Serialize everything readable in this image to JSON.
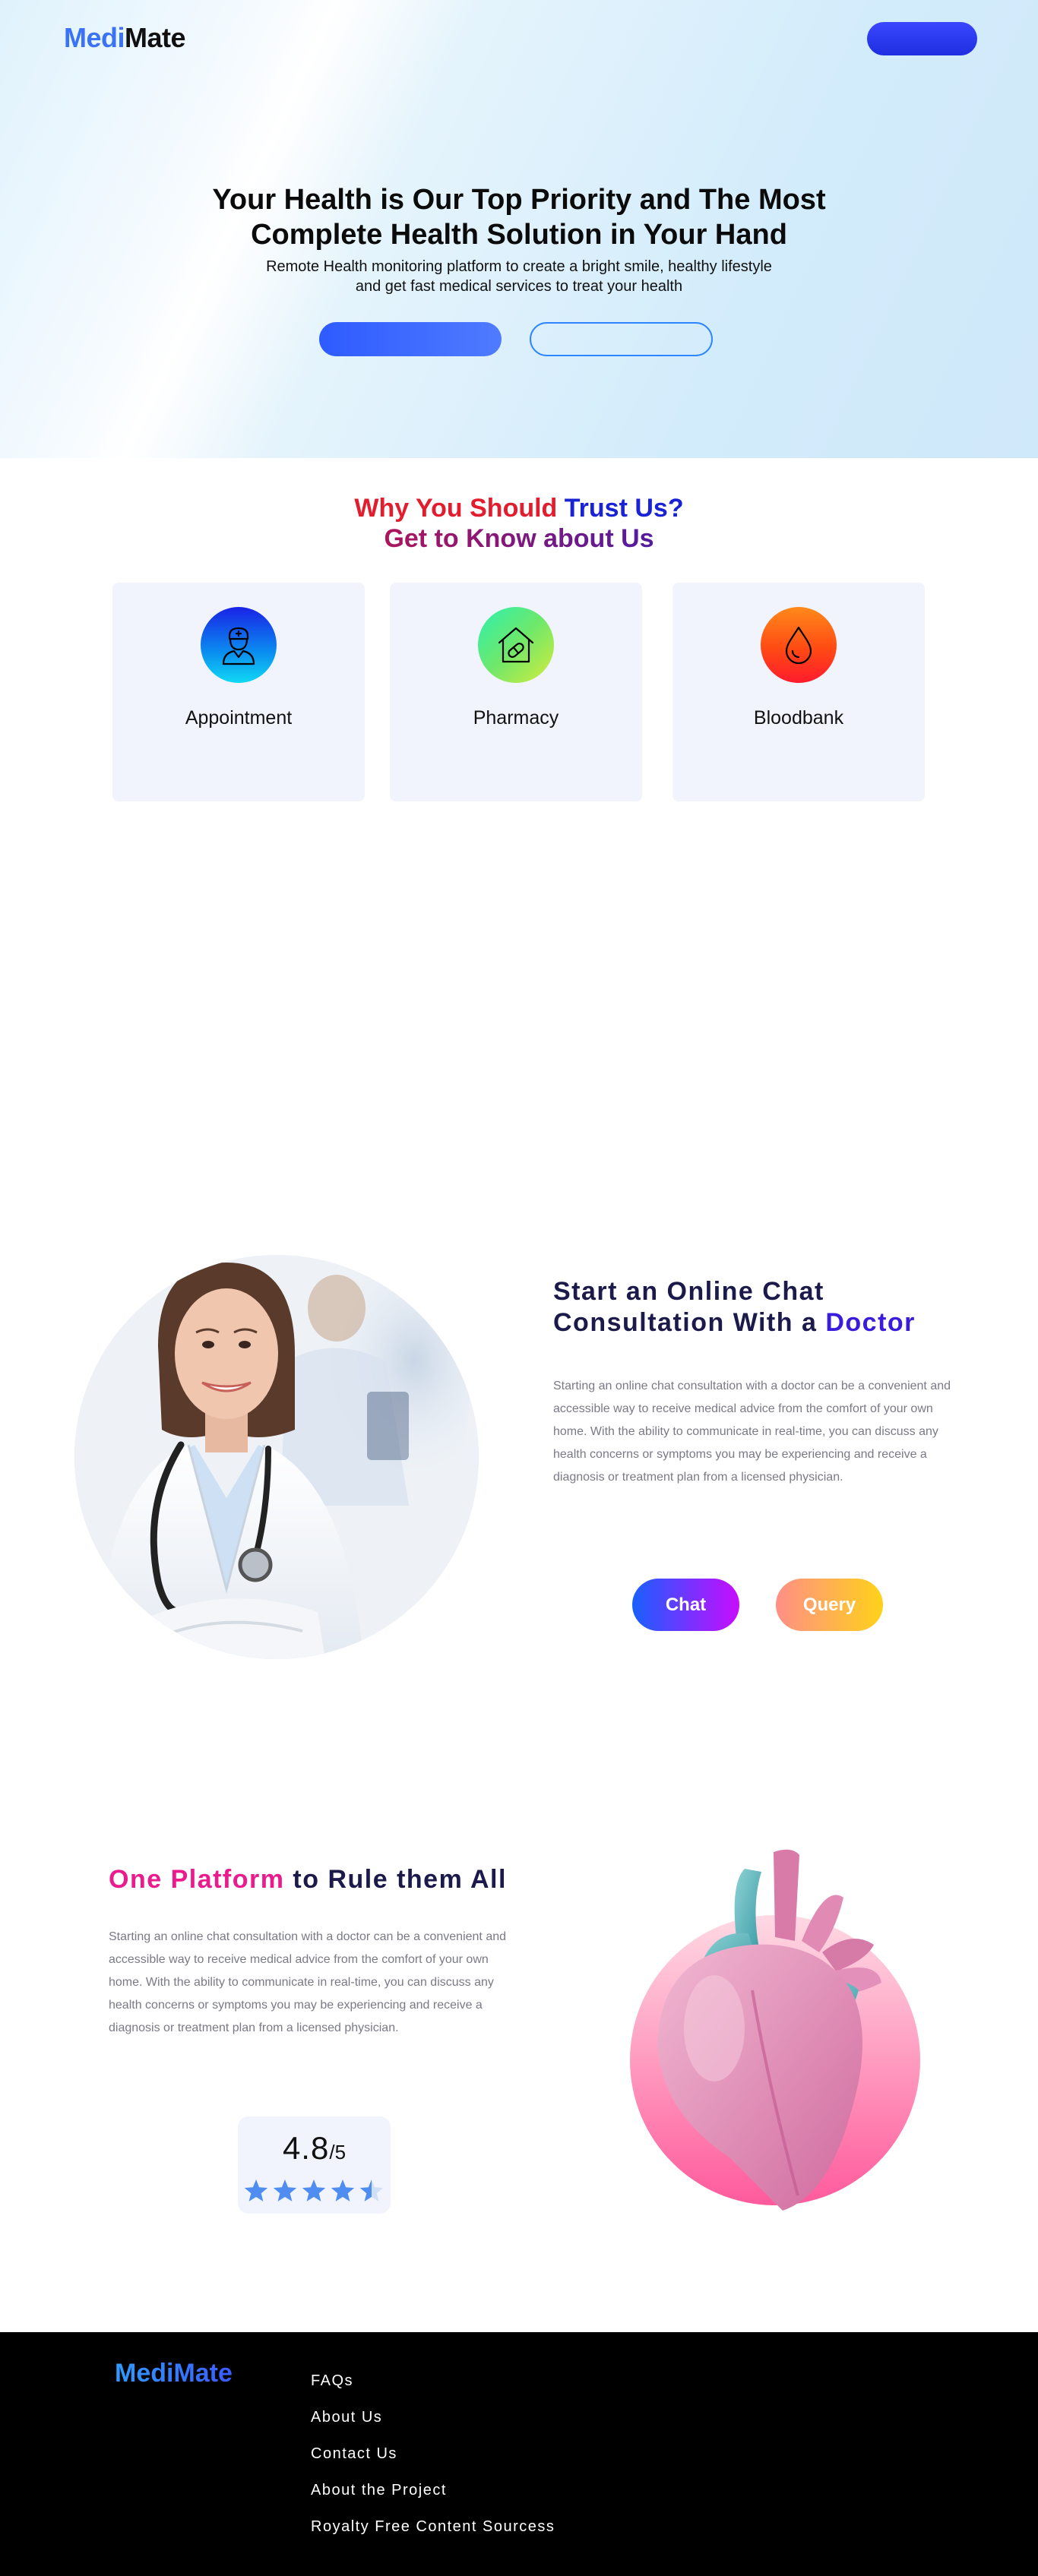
{
  "header": {
    "logo_part1": "Medi",
    "logo_part2": "Mate"
  },
  "hero": {
    "title": "Your Health is Our Top Priority and The Most Complete Health Solution in Your Hand",
    "subtitle": "Remote Health monitoring platform to create a bright smile, healthy lifestyle and get fast medical services to treat your health"
  },
  "why": {
    "line1_part1": "Why You Should ",
    "line1_trust": "Trust",
    "line1_part3": " Us?",
    "line2": "Get to Know about Us",
    "cards": [
      {
        "label": "Appointment",
        "icon": "doctor-icon"
      },
      {
        "label": "Pharmacy",
        "icon": "pharmacy-icon"
      },
      {
        "label": "Bloodbank",
        "icon": "blood-drop-icon"
      }
    ]
  },
  "chat": {
    "title_part1": "Start an Online Chat Consultation With a ",
    "title_highlight": "Doctor",
    "text": "Starting an online chat consultation with a doctor can be a convenient and accessible way to receive medical advice from the comfort of your own home. With the ability to communicate in real-time, you can discuss any health concerns or symptoms you may be experiencing and receive a diagnosis or treatment plan from a licensed physician.",
    "chat_button": "Chat",
    "query_button": "Query"
  },
  "platform": {
    "title_highlight": "One Platform",
    "title_rest": " to Rule them All",
    "text": "Starting an online chat consultation with a doctor can be a convenient and accessible way to receive medical advice from the comfort of your own home. With the ability to communicate in real-time, you can discuss any health concerns or symptoms you may be experiencing and receive a diagnosis or treatment plan from a licensed physician.",
    "rating_value": "4.8",
    "rating_max": "/5",
    "stars": 4.5
  },
  "footer": {
    "logo": "MediMate",
    "links": [
      "FAQs",
      "About Us",
      "Contact Us",
      "About the Project",
      "Royalty Free Content Sourcess"
    ]
  },
  "colors": {
    "accent_blue": "#1a22d6",
    "pink": "#ea1b8c",
    "dark_navy": "#1b1a4a"
  }
}
